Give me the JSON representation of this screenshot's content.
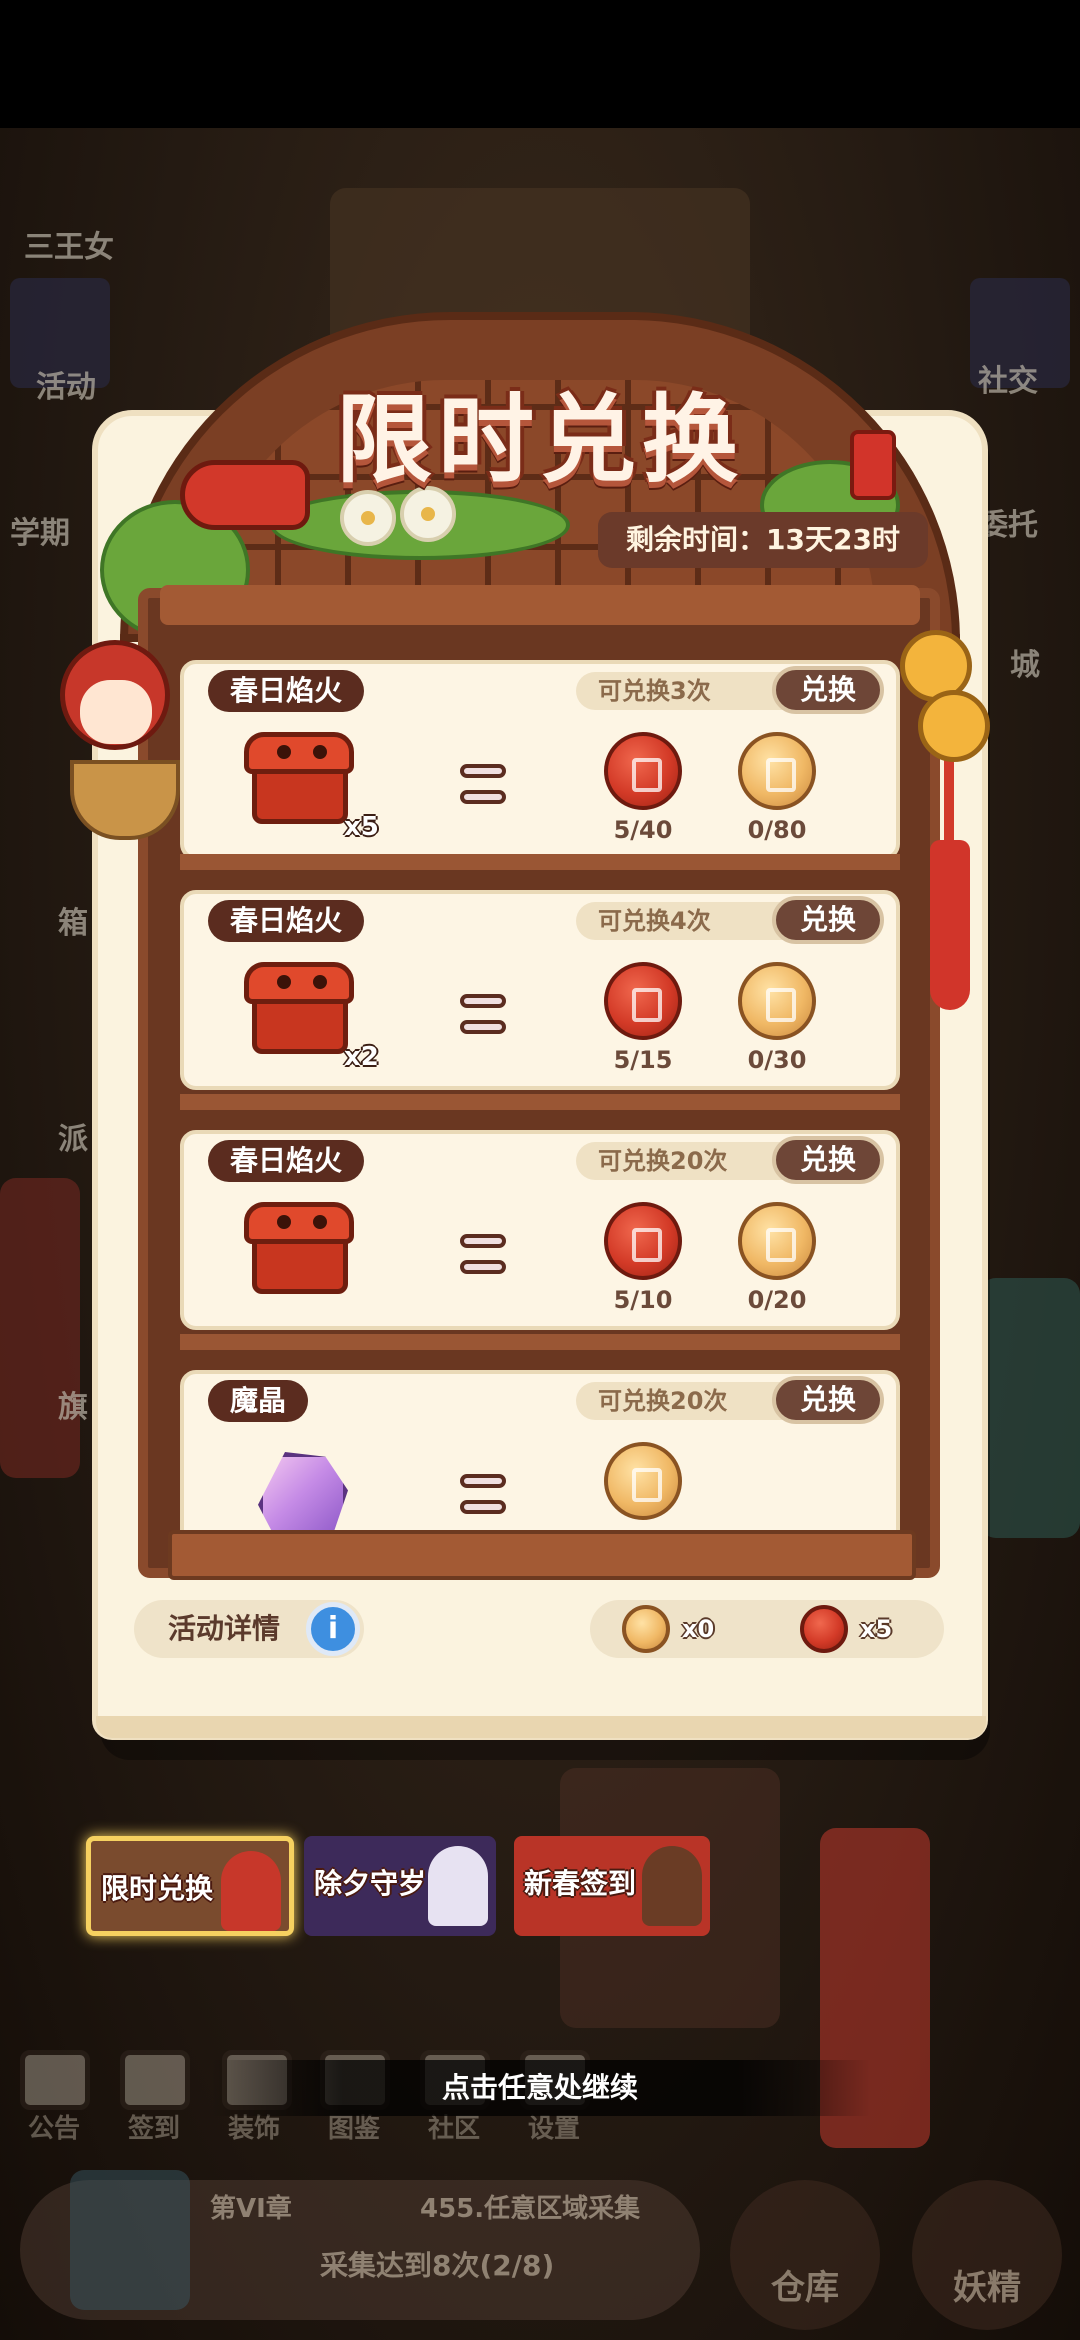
{
  "panel": {
    "title": "限时兑换",
    "remaining_time": "剩余时间：13天23时"
  },
  "background": {
    "left_labels": [
      "三王女",
      "活动",
      "学期",
      "箱",
      "派",
      "旗"
    ],
    "right_labels": [
      "社交",
      "委托",
      "城"
    ]
  },
  "exchanges": [
    {
      "name": "春日焰火",
      "limit": "可兑换3次",
      "button": "兑换",
      "item_icon": "firework-box-icon",
      "quantity": "x5",
      "costs": [
        {
          "icon": "red-coin-icon",
          "text": "5/40",
          "color": "#d33a27"
        },
        {
          "icon": "gold-coin-icon",
          "text": "0/80",
          "color": "#f0b865"
        }
      ]
    },
    {
      "name": "春日焰火",
      "limit": "可兑换4次",
      "button": "兑换",
      "item_icon": "firework-box-icon",
      "quantity": "x2",
      "costs": [
        {
          "icon": "red-coin-icon",
          "text": "5/15",
          "color": "#d33a27"
        },
        {
          "icon": "gold-coin-icon",
          "text": "0/30",
          "color": "#f0b865"
        }
      ]
    },
    {
      "name": "春日焰火",
      "limit": "可兑换20次",
      "button": "兑换",
      "item_icon": "firework-box-icon",
      "quantity": "",
      "costs": [
        {
          "icon": "red-coin-icon",
          "text": "5/10",
          "color": "#d33a27"
        },
        {
          "icon": "gold-coin-icon",
          "text": "0/20",
          "color": "#f0b865"
        }
      ]
    },
    {
      "name": "魔晶",
      "limit": "可兑换20次",
      "button": "兑换",
      "item_icon": "magic-crystal-icon",
      "quantity": "",
      "costs": [
        {
          "icon": "gold-coin-icon",
          "text": "",
          "color": "#f0b865"
        }
      ]
    }
  ],
  "detail": {
    "label": "活动详情",
    "info_icon": "info-icon",
    "balances": [
      {
        "icon": "gold-coin-icon",
        "text": "x0"
      },
      {
        "icon": "red-coin-icon",
        "text": "x5"
      }
    ]
  },
  "event_tabs": [
    {
      "label": "限时兑换",
      "active": true
    },
    {
      "label": "除夕守岁",
      "active": false
    },
    {
      "label": "新春签到",
      "active": false
    }
  ],
  "continue_hint": "点击任意处继续",
  "bottom_nav": [
    "公告",
    "签到",
    "装饰",
    "图鉴",
    "社区",
    "设置"
  ],
  "quest": {
    "chapter": "第VI章",
    "task": "455.任意区域采集",
    "progress": "采集达到8次(2/8)"
  },
  "round_buttons": [
    "仓库",
    "妖精"
  ],
  "colors": {
    "panel": "#fbf3df",
    "wood": "#7b3f24",
    "button": "#6e4637",
    "accent_gold": "#f6d160"
  }
}
